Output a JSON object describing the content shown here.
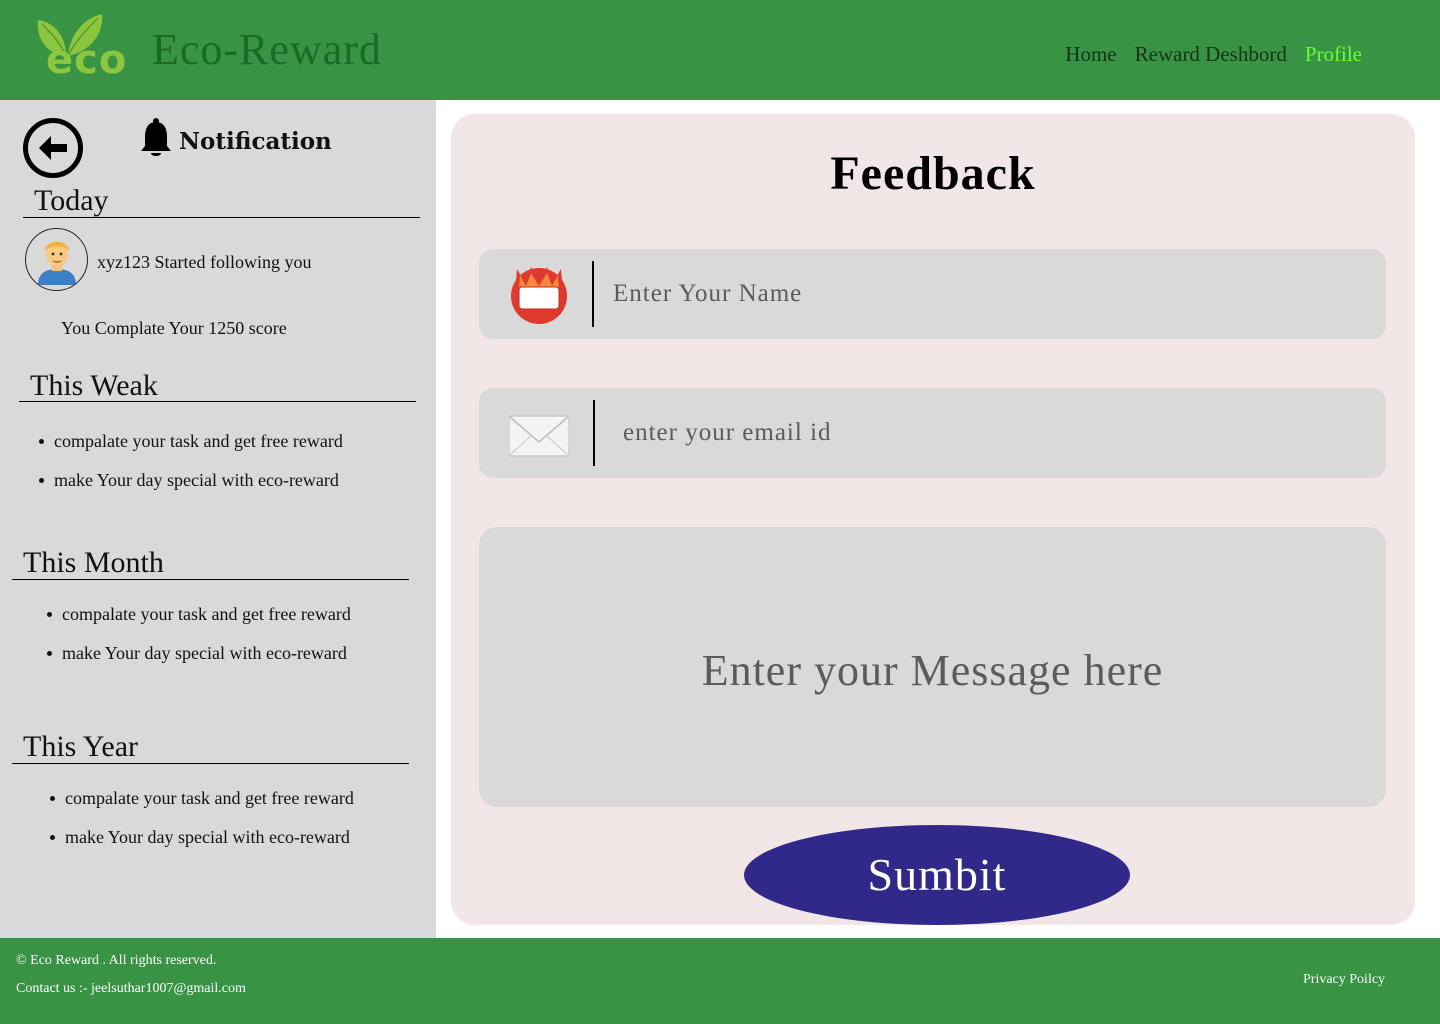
{
  "brand": {
    "logo_text": "eco",
    "name": "Eco-Reward"
  },
  "nav": {
    "items": [
      "Home",
      "Reward Deshbord",
      "Profile"
    ],
    "active": "Profile",
    "active_color": "#6bff3a"
  },
  "sidebar": {
    "title": "Notification",
    "today": {
      "heading": "Today",
      "follow_text": "xyz123 Started following you",
      "score_text": "You Complate Your 1250 score"
    },
    "week": {
      "heading": "This Weak",
      "items": [
        "compalate your task and get free reward",
        "make  Your day special with eco-reward"
      ]
    },
    "month": {
      "heading": "This Month",
      "items": [
        "compalate your task and get free reward",
        "make  Your day special with eco-reward"
      ]
    },
    "year": {
      "heading": "This Year",
      "items": [
        "compalate your task and get free reward",
        "make  Your day special with eco-reward"
      ]
    },
    "icons": [
      "back-arrow-icon",
      "bell-icon",
      "avatar-person-icon"
    ]
  },
  "form": {
    "title": "Feedback",
    "name_placeholder": "Enter Your Name",
    "email_placeholder": "enter your email id",
    "message_placeholder": "Enter your Message here",
    "submit_label": "Sumbit",
    "icons": [
      "name-badge-icon",
      "envelope-icon"
    ]
  },
  "footer": {
    "copyright": "© Eco Reward . All rights reserved.",
    "contact": "Contact us :- jeelsuthar1007@gmail.com",
    "privacy": "Privacy Poilcy"
  },
  "colors": {
    "header_green": "#389344",
    "brand_green": "#1a6b25",
    "sidebar_gray": "#d9d9d9",
    "card_pink": "#f3e6e6",
    "submit_blue": "#31298a"
  }
}
